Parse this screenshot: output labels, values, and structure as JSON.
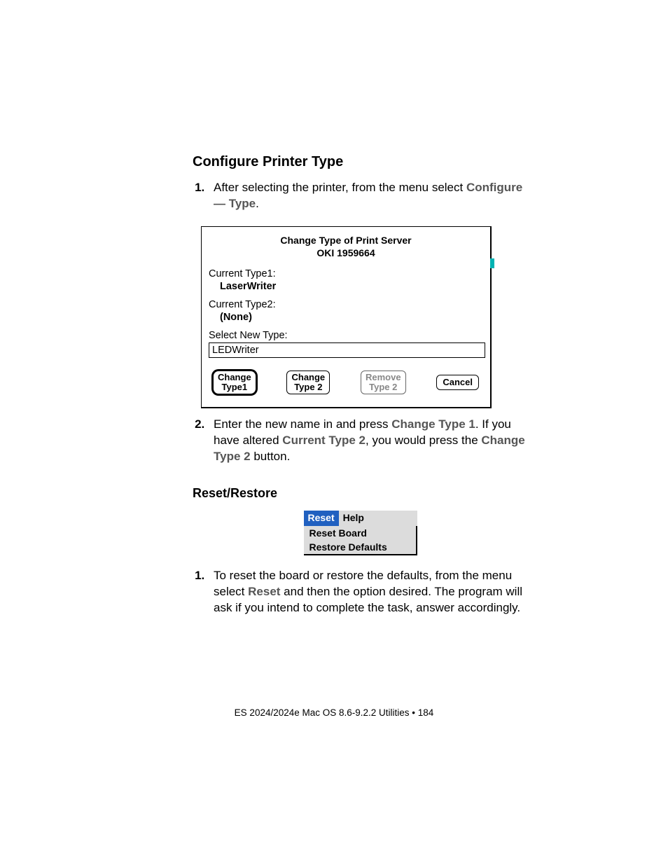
{
  "section1": {
    "heading": "Configure Printer Type",
    "step1_pre": "After selecting the printer, from the menu select ",
    "step1_bold": "Configure — Type",
    "step1_post": "."
  },
  "dialog": {
    "title": "Change Type of Print Server",
    "server_id": "OKI 1959664",
    "type1_label": "Current Type1:",
    "type1_value": "LaserWriter",
    "type2_label": "Current Type2:",
    "type2_value": "(None)",
    "new_label": "Select New Type:",
    "new_value": "LEDWriter",
    "btn_change1_l1": "Change",
    "btn_change1_l2": "Type1",
    "btn_change2_l1": "Change",
    "btn_change2_l2": "Type 2",
    "btn_remove_l1": "Remove",
    "btn_remove_l2": "Type 2",
    "btn_cancel": "Cancel"
  },
  "step2": {
    "pre": "Enter the new name in and press ",
    "b1": "Change Type 1",
    "mid1": ". If you have altered ",
    "b2": "Current Type 2",
    "mid2": ", you would press the ",
    "b3": "Change Type 2",
    "post": " button."
  },
  "section2": {
    "heading": "Reset/Restore"
  },
  "menu": {
    "tab_active": "Reset",
    "tab_other": "Help",
    "opt1": "Reset Board",
    "opt2": "Restore Defaults"
  },
  "step_reset": {
    "pre": "To reset the board or restore the defaults, from the menu select ",
    "b1": "Reset",
    "post": " and then the option desired.  The program will ask if you intend to complete the task, answer accordingly."
  },
  "footer": {
    "text": "ES 2024/2024e Mac OS 8.6-9.2.2 Utilities  • 184"
  }
}
